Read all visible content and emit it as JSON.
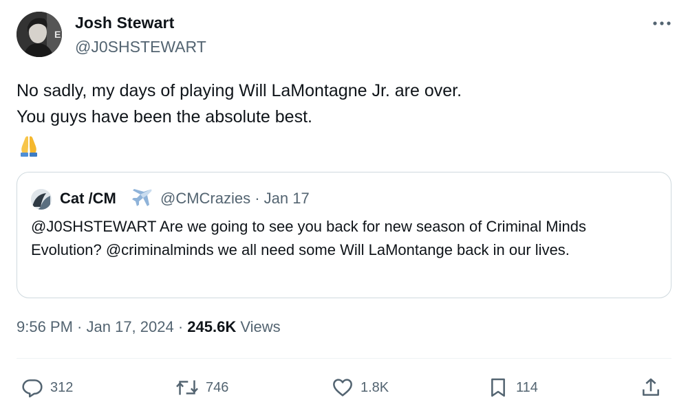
{
  "author": {
    "name": "Josh Stewart",
    "handle": "@J0SHSTEWART",
    "avatar_icon": "profile-photo"
  },
  "tweet": {
    "lines": [
      "No sadly, my days of playing Will LaMontagne Jr. are over.",
      "You guys have been the absolute best."
    ],
    "emoji": "🙏",
    "emoji_icon": "folded-hands-icon"
  },
  "quote": {
    "name": "Cat /CM",
    "name_icon": "airplane-icon",
    "handle_date": "@CMCrazies · Jan 17",
    "text": "@J0SHSTEWART Are we going to see you back for new season of Criminal Minds Evolution? @criminalminds we all need some Will LaMontange back in our lives."
  },
  "meta": {
    "time": "9:56 PM",
    "sep1": " · ",
    "date": "Jan 17, 2024",
    "sep2": " · ",
    "views_count": "245.6K",
    "views_label": " Views"
  },
  "actions": {
    "reply_count": "312",
    "retweet_count": "746",
    "like_count": "1.8K",
    "bookmark_count": "114"
  },
  "colors": {
    "text": "#0f1419",
    "secondary": "#536471",
    "border": "#cfd9de",
    "divider": "#eff3f4"
  }
}
